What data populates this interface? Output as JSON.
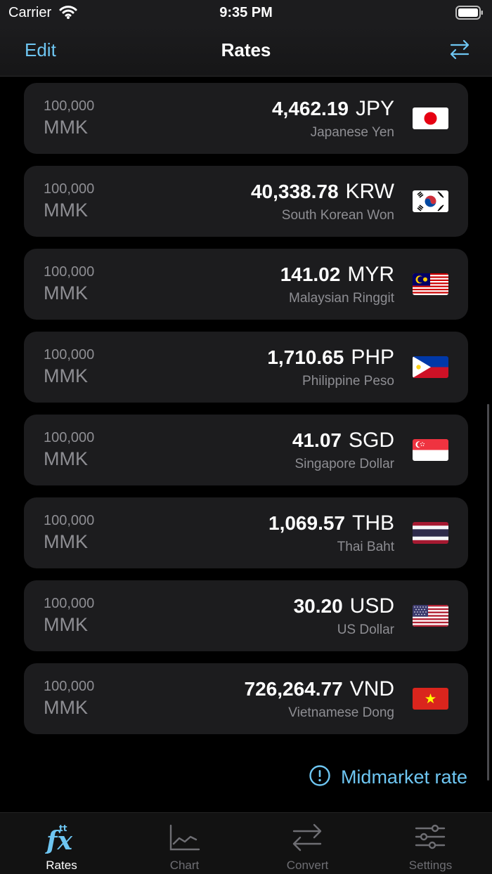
{
  "status": {
    "carrier": "Carrier",
    "time": "9:35 PM"
  },
  "nav": {
    "edit": "Edit",
    "title": "Rates"
  },
  "rates": [
    {
      "base_amount": "100,000",
      "base_code": "MMK",
      "value": "4,462.19",
      "code": "JPY",
      "name": "Japanese Yen",
      "flag": "japan-flag-icon"
    },
    {
      "base_amount": "100,000",
      "base_code": "MMK",
      "value": "40,338.78",
      "code": "KRW",
      "name": "South Korean Won",
      "flag": "south-korea-flag-icon"
    },
    {
      "base_amount": "100,000",
      "base_code": "MMK",
      "value": "141.02",
      "code": "MYR",
      "name": "Malaysian Ringgit",
      "flag": "malaysia-flag-icon"
    },
    {
      "base_amount": "100,000",
      "base_code": "MMK",
      "value": "1,710.65",
      "code": "PHP",
      "name": "Philippine Peso",
      "flag": "philippines-flag-icon"
    },
    {
      "base_amount": "100,000",
      "base_code": "MMK",
      "value": "41.07",
      "code": "SGD",
      "name": "Singapore Dollar",
      "flag": "singapore-flag-icon"
    },
    {
      "base_amount": "100,000",
      "base_code": "MMK",
      "value": "1,069.57",
      "code": "THB",
      "name": "Thai Baht",
      "flag": "thailand-flag-icon"
    },
    {
      "base_amount": "100,000",
      "base_code": "MMK",
      "value": "30.20",
      "code": "USD",
      "name": "US Dollar",
      "flag": "usa-flag-icon"
    },
    {
      "base_amount": "100,000",
      "base_code": "MMK",
      "value": "726,264.77",
      "code": "VND",
      "name": "Vietnamese Dong",
      "flag": "vietnam-flag-icon"
    }
  ],
  "midmarket": {
    "label": "Midmarket rate"
  },
  "tabs": [
    {
      "label": "Rates",
      "icon": "fx-icon",
      "active": true
    },
    {
      "label": "Chart",
      "icon": "chart-icon",
      "active": false
    },
    {
      "label": "Convert",
      "icon": "convert-arrows-icon",
      "active": false
    },
    {
      "label": "Settings",
      "icon": "sliders-icon",
      "active": false
    }
  ],
  "colors": {
    "accent": "#6ec6f2",
    "card": "#1c1c1e",
    "secondary_text": "#8e8e93",
    "background": "#000000"
  }
}
